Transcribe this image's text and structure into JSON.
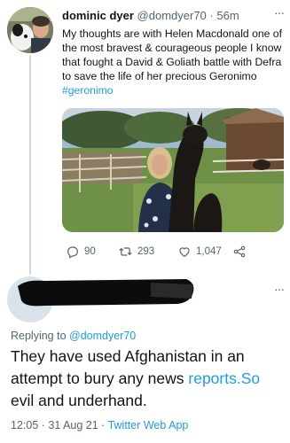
{
  "tweet1": {
    "author_name": "dominic dyer",
    "author_handle": "@domdyer70",
    "separator": "·",
    "time": "56m",
    "more_label": "···",
    "text_main": "My thoughts are with Helen Macdonald one of the most bravest & courageous people I know that fought a David & Goliath battle with Defra to save the life of her precious Geronimo ",
    "hashtag": "#geronimo",
    "stats": {
      "replies": "90",
      "retweets": "293",
      "likes": "1,047"
    },
    "icons": [
      "reply-icon",
      "retweet-icon",
      "like-icon",
      "share-icon"
    ]
  },
  "tweet2": {
    "more_label": "···",
    "replying_prefix": "Replying to ",
    "replying_handle": "@domdyer70",
    "text_part1": "They have used  Afghanistan in an attempt to bury any news ",
    "text_link": "reports.So",
    "text_part2": " evil and underhand.",
    "timestamp": "12:05 · 31 Aug 21 · ",
    "source": "Twitter Web App"
  },
  "colors": {
    "accent": "#1d9bf0",
    "muted": "#536471",
    "text": "#0f1419",
    "line": "#cfd9de"
  }
}
